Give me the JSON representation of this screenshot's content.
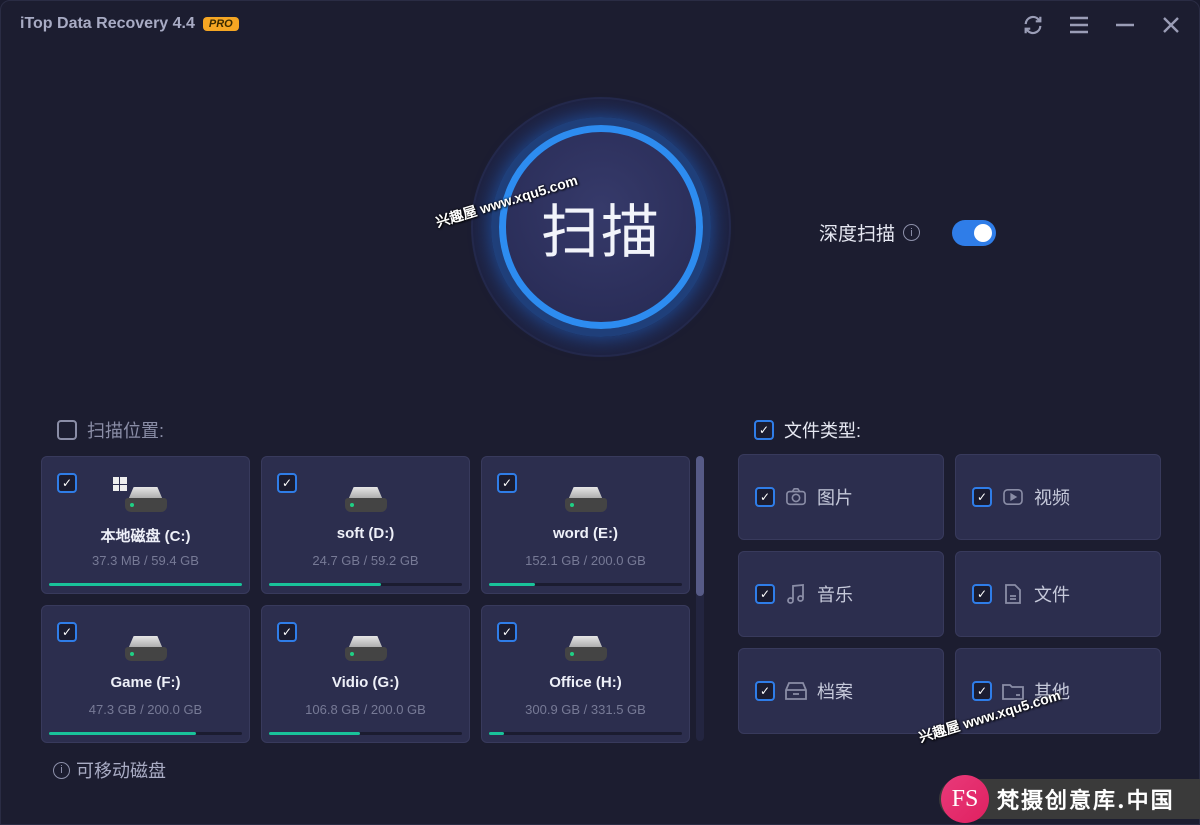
{
  "app": {
    "title": "iTop Data Recovery 4.4",
    "badge": "PRO"
  },
  "window_controls": [
    {
      "name": "refresh",
      "icon": "refresh-icon"
    },
    {
      "name": "menu",
      "icon": "menu-icon"
    },
    {
      "name": "minimize",
      "icon": "minimize-icon"
    },
    {
      "name": "close",
      "icon": "close-icon"
    }
  ],
  "scan": {
    "label": "扫描"
  },
  "deep_scan": {
    "label": "深度扫描",
    "enabled": true
  },
  "locations": {
    "header": "扫描位置:",
    "checked": false,
    "drives": [
      {
        "name": "本地磁盘 (C:)",
        "size": "37.3 MB / 59.4 GB",
        "checked": true,
        "system": true,
        "fill": 1.0
      },
      {
        "name": "soft (D:)",
        "size": "24.7 GB / 59.2 GB",
        "checked": true,
        "system": false,
        "fill": 0.58
      },
      {
        "name": "word (E:)",
        "size": "152.1 GB / 200.0 GB",
        "checked": true,
        "system": false,
        "fill": 0.24
      },
      {
        "name": "Game (F:)",
        "size": "47.3 GB / 200.0 GB",
        "checked": true,
        "system": false,
        "fill": 0.76
      },
      {
        "name": "Vidio (G:)",
        "size": "106.8 GB / 200.0 GB",
        "checked": true,
        "system": false,
        "fill": 0.47
      },
      {
        "name": "Office (H:)",
        "size": "300.9 GB / 331.5 GB",
        "checked": true,
        "system": false,
        "fill": 0.08
      }
    ],
    "removable": "可移动磁盘"
  },
  "file_types": {
    "header": "文件类型:",
    "checked": true,
    "items": [
      {
        "label": "图片",
        "icon": "camera-icon",
        "checked": true
      },
      {
        "label": "视频",
        "icon": "video-icon",
        "checked": true
      },
      {
        "label": "音乐",
        "icon": "music-icon",
        "checked": true
      },
      {
        "label": "文件",
        "icon": "document-icon",
        "checked": true
      },
      {
        "label": "档案",
        "icon": "archive-icon",
        "checked": true
      },
      {
        "label": "其他",
        "icon": "folder-icon",
        "checked": true
      }
    ]
  },
  "watermarks": [
    "兴趣屋 www.xqu5.com",
    "兴趣屋 www.xqu5.com"
  ],
  "brand": {
    "logo": "FS",
    "text": "梵摄创意库.中国"
  },
  "colors": {
    "accent": "#2f7de8",
    "progress": "#19c39a",
    "badge": "#f5a623"
  }
}
